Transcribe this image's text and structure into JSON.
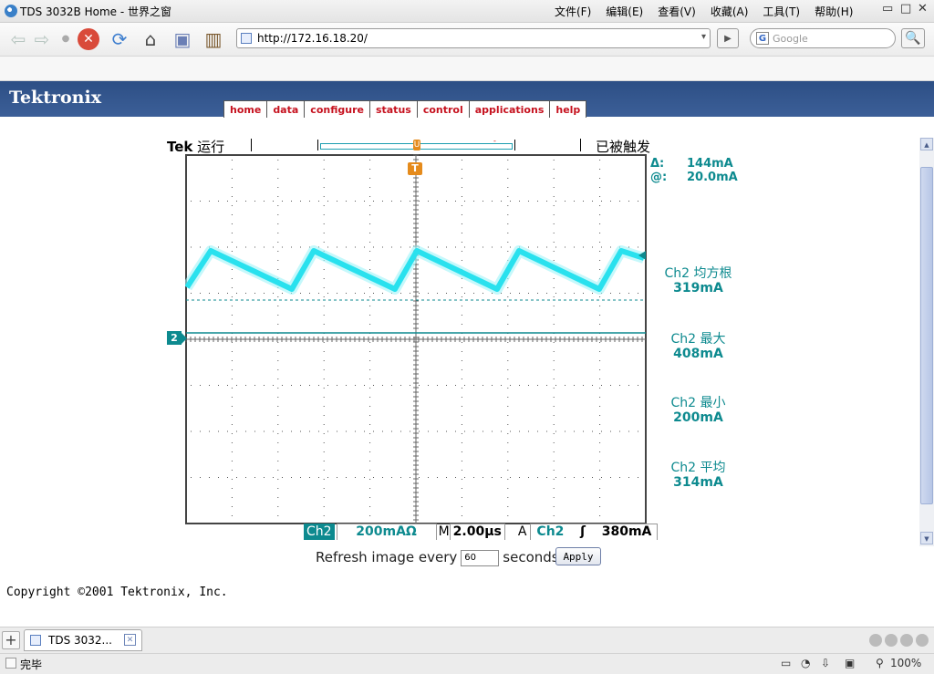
{
  "window": {
    "title": "TDS 3032B Home - 世界之窗",
    "menu": [
      "文件(F)",
      "编辑(E)",
      "查看(V)",
      "收藏(A)",
      "工具(T)",
      "帮助(H)"
    ],
    "controls": [
      "▭",
      "□",
      "✕"
    ]
  },
  "toolbar": {
    "back_icon": "back-arrow-icon",
    "forward_icon": "forward-arrow-icon",
    "stop_icon": "stop-icon",
    "refresh_icon": "refresh-icon",
    "home_icon": "home-icon",
    "address_value": "http://172.16.18.20/",
    "address_dropdown": "▾",
    "go_glyph": "▶",
    "search_placeholder": "Google",
    "search_engine_letter": "G",
    "search_glyph": "🔍"
  },
  "site": {
    "brand": "Tektronix",
    "nav": [
      "home",
      "data",
      "configure",
      "status",
      "control",
      "applications",
      "help"
    ],
    "brand_color": "#2d4f85",
    "nav_color": "#c6121f"
  },
  "scope": {
    "tek_label": "Tek",
    "run_state": "运行",
    "trigger_state": "已被触发",
    "trigger_marker": "T",
    "position_marker": "U",
    "channel_marker": "2",
    "cursor": {
      "delta_label": "Δ:",
      "delta_value": "144mA",
      "at_label": "@:",
      "at_value": "20.0mA"
    },
    "measurements": [
      {
        "label": "Ch2 均方根",
        "value": "319mA"
      },
      {
        "label": "Ch2 最大",
        "value": "408mA"
      },
      {
        "label": "Ch2 最小",
        "value": "200mA"
      },
      {
        "label": "Ch2 平均",
        "value": "314mA"
      }
    ],
    "status": {
      "channel": "Ch2",
      "vertical_scale": "200mAΩ",
      "time_label": "M",
      "timebase": "2.00µs",
      "trigger_label": "A",
      "trigger_source": "Ch2",
      "trigger_slope": "ʃ",
      "trigger_level": "380mA"
    },
    "trace_color": "#29e1ee",
    "readout_color": "#0d8a8f",
    "trigger_color": "#e58b1c"
  },
  "refresh": {
    "label_before": "Refresh image every",
    "value": "60",
    "label_after": "seconds",
    "apply": "Apply"
  },
  "footer": {
    "copyright": "Copyright ©2001 Tektronix, Inc."
  },
  "tabs": [
    {
      "title": "TDS 3032...",
      "close": "✕"
    }
  ],
  "statusbar": {
    "text": "完毕",
    "zoom": "100%"
  }
}
